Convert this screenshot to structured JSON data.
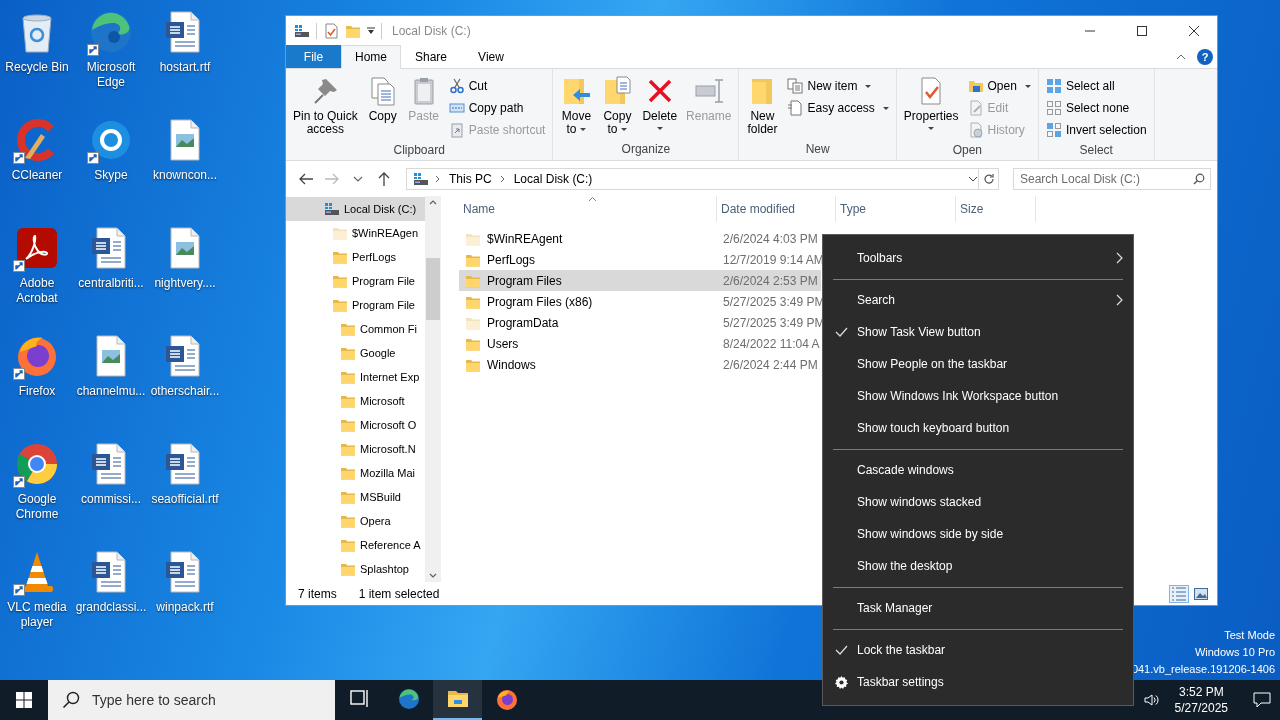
{
  "desktop_icons": [
    {
      "label": "Recycle Bin",
      "shortcut": false
    },
    {
      "label": "Microsoft Edge",
      "shortcut": true
    },
    {
      "label": "hostart.rtf",
      "shortcut": false
    },
    {
      "label": "CCleaner",
      "shortcut": true
    },
    {
      "label": "Skype",
      "shortcut": true
    },
    {
      "label": "knowncon...",
      "shortcut": false
    },
    {
      "label": "Adobe Acrobat",
      "shortcut": true
    },
    {
      "label": "centralbriti...",
      "shortcut": false
    },
    {
      "label": "nightvery....",
      "shortcut": false
    },
    {
      "label": "Firefox",
      "shortcut": true
    },
    {
      "label": "channelmu...",
      "shortcut": false
    },
    {
      "label": "otherschair...",
      "shortcut": false
    },
    {
      "label": "Google Chrome",
      "shortcut": true
    },
    {
      "label": "commissi...",
      "shortcut": false
    },
    {
      "label": "seaofficial.rtf",
      "shortcut": false
    },
    {
      "label": "VLC media player",
      "shortcut": true
    },
    {
      "label": "grandclassi...",
      "shortcut": false
    },
    {
      "label": "winpack.rtf",
      "shortcut": false
    }
  ],
  "explorer": {
    "title": "Local Disk (C:)",
    "tabs": [
      {
        "label": "File",
        "kind": "menu"
      },
      {
        "label": "Home",
        "kind": "tab",
        "selected": true
      },
      {
        "label": "Share",
        "kind": "tab",
        "selected": false
      },
      {
        "label": "View",
        "kind": "tab",
        "selected": false
      }
    ],
    "help": "?",
    "ribbon_groups": [
      {
        "label": "Clipboard",
        "items": [
          {
            "label": "Pin to Quick\naccess",
            "kind": "large",
            "disabled": false,
            "dropdown": false
          },
          {
            "label": "Copy",
            "kind": "large",
            "disabled": false,
            "dropdown": false
          },
          {
            "label": "Paste",
            "kind": "large",
            "disabled": true,
            "dropdown": false
          },
          {
            "label": "Cut",
            "kind": "small",
            "disabled": false,
            "dropdown": false
          },
          {
            "label": "Copy path",
            "kind": "small",
            "disabled": false,
            "dropdown": false
          },
          {
            "label": "Paste shortcut",
            "kind": "small",
            "disabled": true,
            "dropdown": false
          }
        ]
      },
      {
        "label": "Organize",
        "items": [
          {
            "label": "Move\nto",
            "kind": "large",
            "disabled": false,
            "dropdown": true
          },
          {
            "label": "Copy\nto",
            "kind": "large",
            "disabled": false,
            "dropdown": true
          },
          {
            "label": "Delete",
            "kind": "large",
            "disabled": false,
            "dropdown": true
          },
          {
            "label": "Rename",
            "kind": "large",
            "disabled": true,
            "dropdown": false
          }
        ]
      },
      {
        "label": "New",
        "items": [
          {
            "label": "New\nfolder",
            "kind": "large",
            "disabled": false,
            "dropdown": false
          },
          {
            "label": "New item",
            "kind": "small",
            "disabled": false,
            "dropdown": true
          },
          {
            "label": "Easy access",
            "kind": "small",
            "disabled": false,
            "dropdown": true
          }
        ]
      },
      {
        "label": "Open",
        "items": [
          {
            "label": "Properties",
            "kind": "large",
            "disabled": false,
            "dropdown": true
          },
          {
            "label": "Open",
            "kind": "small",
            "disabled": false,
            "dropdown": true
          },
          {
            "label": "Edit",
            "kind": "small",
            "disabled": true,
            "dropdown": false
          },
          {
            "label": "History",
            "kind": "small",
            "disabled": true,
            "dropdown": false
          }
        ]
      },
      {
        "label": "Select",
        "items": [
          {
            "label": "Select all",
            "kind": "small",
            "disabled": false,
            "dropdown": false
          },
          {
            "label": "Select none",
            "kind": "small",
            "disabled": false,
            "dropdown": false
          },
          {
            "label": "Invert selection",
            "kind": "small",
            "disabled": false,
            "dropdown": false
          }
        ]
      }
    ],
    "address": {
      "crumbs": [
        "This PC",
        "Local Disk (C:)"
      ]
    },
    "search": {
      "placeholder": "Search Local Disk (C:)"
    },
    "tree": [
      {
        "label": "Local Disk (C:)",
        "selected": true,
        "hidden": false,
        "children": [
          {
            "label": "$WinREAgen",
            "selected": false,
            "hidden": true
          },
          {
            "label": "PerfLogs",
            "selected": false,
            "hidden": false
          },
          {
            "label": "Program File",
            "selected": false,
            "hidden": false
          },
          {
            "label": "Program File",
            "selected": false,
            "hidden": false,
            "children": [
              {
                "label": "Common Fi",
                "selected": false,
                "hidden": false
              },
              {
                "label": "Google",
                "selected": false,
                "hidden": false
              },
              {
                "label": "Internet Exp",
                "selected": false,
                "hidden": false
              },
              {
                "label": "Microsoft",
                "selected": false,
                "hidden": false
              },
              {
                "label": "Microsoft O",
                "selected": false,
                "hidden": false
              },
              {
                "label": "Microsoft.N",
                "selected": false,
                "hidden": false
              },
              {
                "label": "Mozilla Mai",
                "selected": false,
                "hidden": false
              },
              {
                "label": "MSBuild",
                "selected": false,
                "hidden": false
              },
              {
                "label": "Opera",
                "selected": false,
                "hidden": false
              },
              {
                "label": "Reference A",
                "selected": false,
                "hidden": false
              },
              {
                "label": "Splashtop",
                "selected": false,
                "hidden": false
              }
            ]
          }
        ]
      }
    ],
    "columns": [
      {
        "label": "Name",
        "sorted": true
      },
      {
        "label": "Date modified",
        "sorted": false
      },
      {
        "label": "Type",
        "sorted": false
      },
      {
        "label": "Size",
        "sorted": false
      }
    ],
    "rows": [
      {
        "name": "$WinREAgent",
        "date": "2/6/2024 4:03 PM",
        "hidden": true,
        "selected": false
      },
      {
        "name": "PerfLogs",
        "date": "12/7/2019 9:14 AM",
        "hidden": false,
        "selected": false
      },
      {
        "name": "Program Files",
        "date": "2/6/2024 2:53 PM",
        "hidden": false,
        "selected": true
      },
      {
        "name": "Program Files (x86)",
        "date": "5/27/2025 3:49 PM",
        "hidden": false,
        "selected": false
      },
      {
        "name": "ProgramData",
        "date": "5/27/2025 3:49 PM",
        "hidden": true,
        "selected": false
      },
      {
        "name": "Users",
        "date": "8/24/2022 11:04 A",
        "hidden": false,
        "selected": false
      },
      {
        "name": "Windows",
        "date": "2/6/2024 2:44 PM",
        "hidden": false,
        "selected": false
      }
    ],
    "status": {
      "count": "7 items",
      "selection": "1 item selected"
    },
    "views": [
      {
        "kind": "details",
        "selected": true
      },
      {
        "kind": "large_icons",
        "selected": false
      }
    ]
  },
  "os_notice": [
    "Test Mode",
    "Windows 10 Pro",
    "041.vb_release.191206-1406"
  ],
  "context_menu": {
    "items": [
      {
        "kind": "item",
        "label": "Toolbars",
        "checked": false,
        "submenu": true
      },
      {
        "kind": "separator"
      },
      {
        "kind": "item",
        "label": "Search",
        "checked": false,
        "submenu": true
      },
      {
        "kind": "item",
        "label": "Show Task View button",
        "checked": true,
        "submenu": false
      },
      {
        "kind": "item",
        "label": "Show People on the taskbar",
        "checked": false,
        "submenu": false
      },
      {
        "kind": "item",
        "label": "Show Windows Ink Workspace button",
        "checked": false,
        "submenu": false
      },
      {
        "kind": "item",
        "label": "Show touch keyboard button",
        "checked": false,
        "submenu": false
      },
      {
        "kind": "separator"
      },
      {
        "kind": "item",
        "label": "Cascade windows",
        "checked": false,
        "submenu": false
      },
      {
        "kind": "item",
        "label": "Show windows stacked",
        "checked": false,
        "submenu": false
      },
      {
        "kind": "item",
        "label": "Show windows side by side",
        "checked": false,
        "submenu": false
      },
      {
        "kind": "item",
        "label": "Show the desktop",
        "checked": false,
        "submenu": false
      },
      {
        "kind": "separator"
      },
      {
        "kind": "item",
        "label": "Task Manager",
        "checked": false,
        "submenu": false
      },
      {
        "kind": "separator"
      },
      {
        "kind": "item",
        "label": "Lock the taskbar",
        "checked": true,
        "submenu": false
      },
      {
        "kind": "settings",
        "label": "Taskbar settings",
        "submenu": false
      }
    ]
  },
  "taskbar": {
    "search": {
      "placeholder": "Type here to search"
    },
    "apps": [
      {
        "kind": "task_view",
        "running": false
      },
      {
        "kind": "edge",
        "running": false
      },
      {
        "kind": "explorer",
        "running": true
      },
      {
        "kind": "firefox",
        "running": false
      }
    ],
    "clock": {
      "time": "3:52 PM",
      "date": "5/27/2025"
    }
  }
}
